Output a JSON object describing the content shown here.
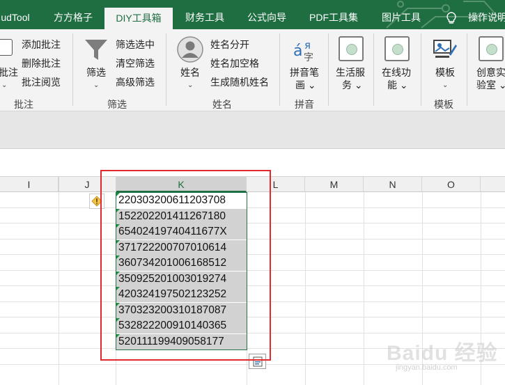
{
  "tabs": [
    "udTool",
    "方方格子",
    "DIY工具箱",
    "财务工具",
    "公式向导",
    "PDF工具集",
    "图片工具"
  ],
  "tell_me": "操作说明",
  "ribbon": {
    "comment": {
      "add": "添加批注",
      "delete": "删除批注",
      "review": "批注阅览",
      "big_label": "批注",
      "chev": "⌄",
      "group": "批注"
    },
    "filter": {
      "big_label": "筛选",
      "chev": "⌄",
      "filter_selected": "筛选选中",
      "clear_filter": "清空筛选",
      "advanced_filter": "高级筛选",
      "group": "筛选"
    },
    "name": {
      "big_label": "姓名",
      "chev": "⌄",
      "split": "姓名分开",
      "add_space": "姓名加空格",
      "random": "生成随机姓名",
      "group": "姓名"
    },
    "pinyin": {
      "label1": "拼音笔",
      "label2": "画 ⌄",
      "group": "拼音"
    },
    "life": {
      "label1": "生活服",
      "label2": "务 ⌄"
    },
    "online": {
      "label1": "在线功",
      "label2": "能 ⌄"
    },
    "template": {
      "label": "模板",
      "chev": "⌄",
      "group": "模板"
    },
    "lab": {
      "label1": "创意实",
      "label2": "验室 ⌄"
    }
  },
  "columns": [
    "I",
    "J",
    "K",
    "L",
    "M",
    "N",
    "O"
  ],
  "cells": [
    "220303200611203708",
    "152202201411267180",
    "65402419740411677X",
    "371722200707010614",
    "360734201006168512",
    "350925201003019274",
    "420324197502123252",
    "370323200310187087",
    "532822200910140365",
    "520111199409058177"
  ],
  "watermark": {
    "main": "Baidu 经验",
    "sub": "jingyan.baidu.com"
  }
}
